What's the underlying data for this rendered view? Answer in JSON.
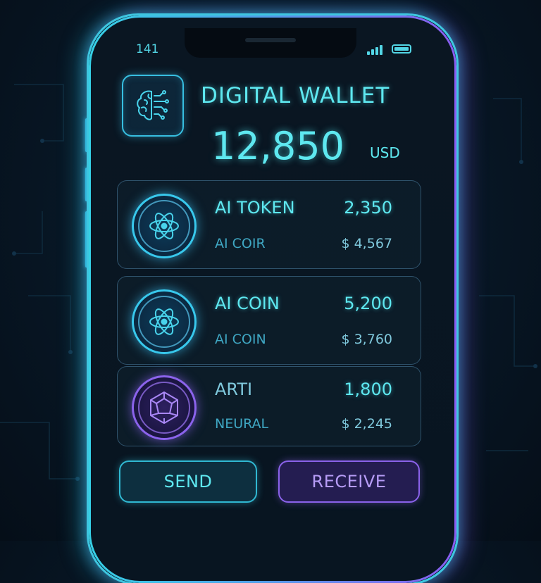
{
  "status_bar": {
    "time": "141"
  },
  "header": {
    "title": "DIGITAL WALLET",
    "balance": "12,850",
    "currency": "USD"
  },
  "assets": [
    {
      "name": "AI TOKEN",
      "amount": "2,350",
      "subtitle": "AI COIR",
      "usd": "$ 4,567",
      "icon": "atom-icon"
    },
    {
      "name": "AI COIN",
      "amount": "5,200",
      "subtitle": "AI COIN",
      "usd": "$ 3,760",
      "icon": "atom-icon"
    },
    {
      "name": "ARTI",
      "amount": "1,800",
      "subtitle": "NEURAL",
      "usd": "$ 2,245",
      "icon": "hexagon-gem-icon"
    }
  ],
  "actions": {
    "send": "SEND",
    "receive": "RECEIVE"
  },
  "colors": {
    "cyan": "#5ee8f0",
    "purple": "#8a62ea",
    "background": "#081827"
  }
}
